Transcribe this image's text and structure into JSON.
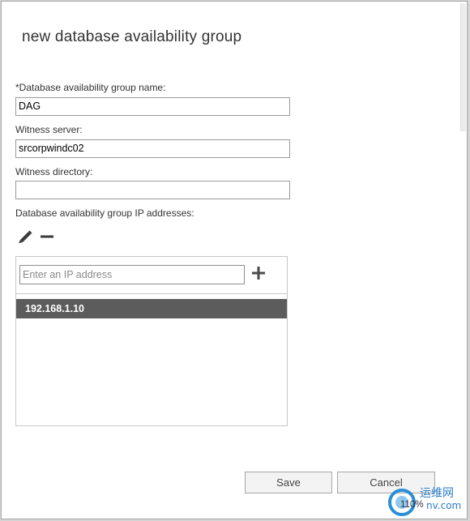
{
  "dialog": {
    "title": "new database availability group"
  },
  "form": {
    "dag_name_label": "*Database availability group name:",
    "dag_name_value": "DAG",
    "witness_server_label": "Witness server:",
    "witness_server_value": "srcorpwindc02",
    "witness_directory_label": "Witness directory:",
    "witness_directory_value": "",
    "ip_addresses_label": "Database availability group IP addresses:"
  },
  "ip_panel": {
    "input_placeholder": "Enter an IP address",
    "addresses": [
      "192.168.1.10"
    ]
  },
  "buttons": {
    "save_label": "Save",
    "cancel_label": "Cancel"
  },
  "icons": {
    "edit": "pencil-icon",
    "remove": "minus-icon",
    "add": "plus-icon"
  },
  "watermark": {
    "site_name": "运维网",
    "zoom": "110%"
  },
  "colors": {
    "selected_row_bg": "#5c5c5c",
    "button_bg": "#f3f3f3",
    "text": "#333333"
  }
}
